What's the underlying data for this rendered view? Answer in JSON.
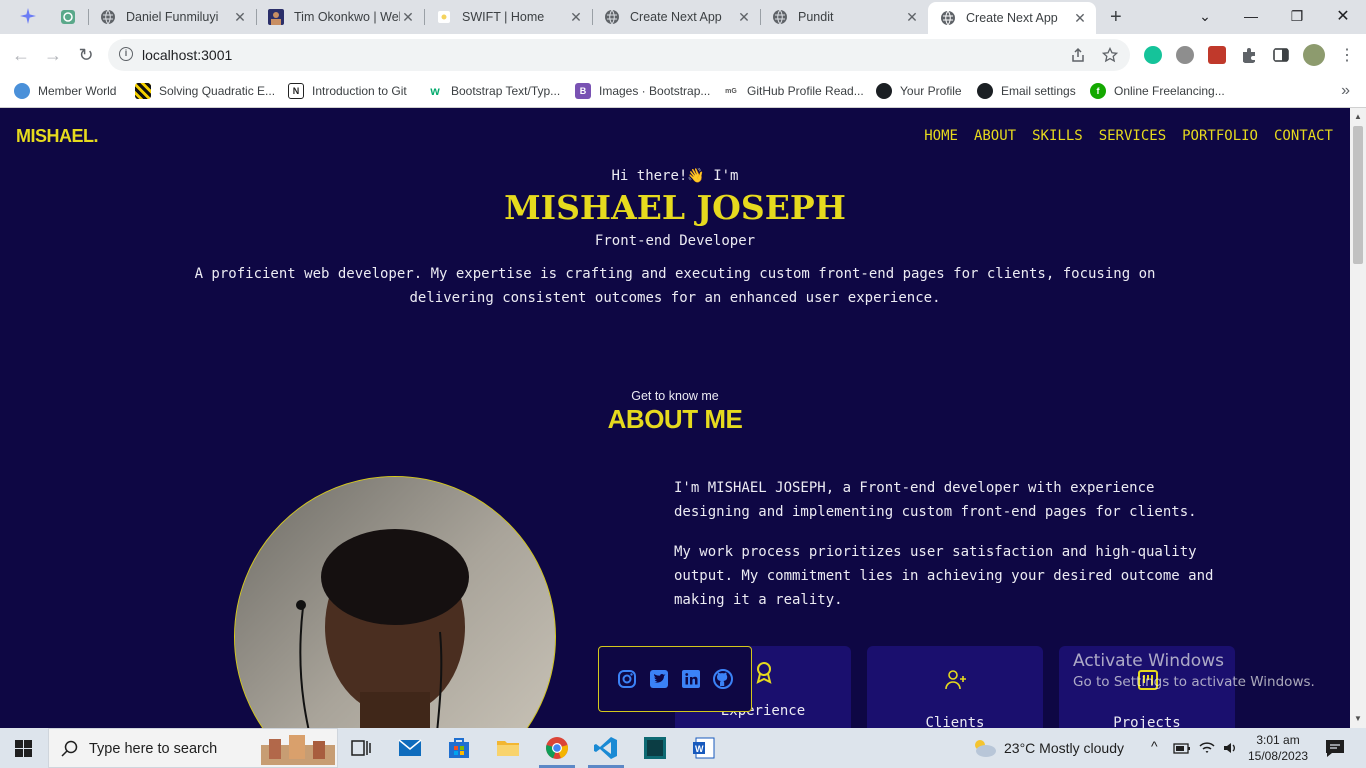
{
  "browser": {
    "tabs": [
      {
        "title": "",
        "icon": "chatgpt-icon"
      },
      {
        "title": "Daniel Funmiluyi",
        "icon": "globe-icon"
      },
      {
        "title": "Tim Okonkwo | Web",
        "icon": "profile-thumb-icon"
      },
      {
        "title": "SWIFT | Home",
        "icon": "swift-icon"
      },
      {
        "title": "Create Next App",
        "icon": "globe-icon"
      },
      {
        "title": "Pundit",
        "icon": "globe-icon"
      },
      {
        "title": "Create Next App",
        "icon": "globe-icon",
        "active": true
      }
    ],
    "url": "localhost:3001",
    "bookmarks": [
      {
        "label": "Member World",
        "icon": "member-world-icon"
      },
      {
        "label": "Solving Quadratic E...",
        "icon": "stripes-icon"
      },
      {
        "label": "Introduction to Git",
        "icon": "notion-icon"
      },
      {
        "label": "Bootstrap Text/Typ...",
        "icon": "w3-icon"
      },
      {
        "label": "Images · Bootstrap...",
        "icon": "bootstrap-icon"
      },
      {
        "label": "GitHub Profile Read...",
        "icon": "mdg-icon"
      },
      {
        "label": "Your Profile",
        "icon": "github-icon"
      },
      {
        "label": "Email settings",
        "icon": "github-icon"
      },
      {
        "label": "Online Freelancing...",
        "icon": "freelance-icon"
      }
    ]
  },
  "site": {
    "logo": "MISHAEL.",
    "nav": [
      "HOME",
      "ABOUT",
      "SKILLS",
      "SERVICES",
      "PORTFOLIO",
      "CONTACT"
    ],
    "hero": {
      "greeting": "Hi there!👋 I'm",
      "name": "MISHAEL JOSEPH",
      "role": "Front-end Developer",
      "bio": "A proficient web developer. My expertise is crafting and executing custom front-end pages for clients, focusing on delivering consistent outcomes for an enhanced user experience."
    },
    "about": {
      "kicker": "Get to know me",
      "heading": "ABOUT ME",
      "p1": "I'm MISHAEL JOSEPH, a Front-end developer with experience designing and implementing custom front-end pages for clients.",
      "p2": "My work process prioritizes user satisfaction and high-quality output. My commitment lies in achieving your desired outcome and making it a reality.",
      "cards": [
        {
          "label": "Experience",
          "icon": "award-icon"
        },
        {
          "label": "Clients",
          "icon": "user-plus-icon"
        },
        {
          "label": "Projects",
          "icon": "projects-icon"
        }
      ]
    },
    "socials": [
      "instagram-icon",
      "twitter-icon",
      "linkedin-icon",
      "github-icon"
    ],
    "accent": "#e6da1e",
    "background": "#0e0744"
  },
  "watermark": {
    "line1": "Activate Windows",
    "line2": "Go to Settings to activate Windows."
  },
  "taskbar": {
    "search_placeholder": "Type here to search",
    "weather": "23°C  Mostly cloudy",
    "time": "3:01 am",
    "date": "15/08/2023"
  }
}
